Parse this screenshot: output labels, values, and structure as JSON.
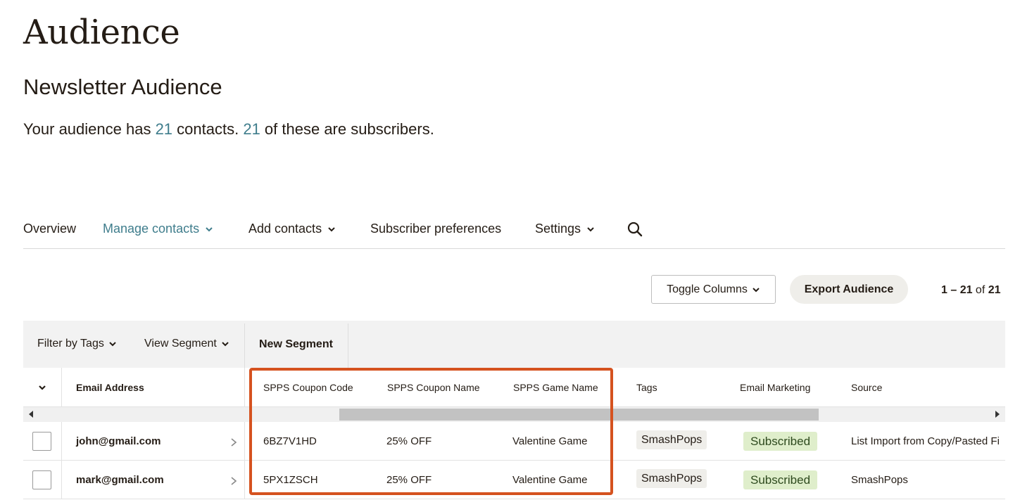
{
  "header": {
    "title": "Audience",
    "audience_name": "Newsletter Audience",
    "summary": {
      "prefix": "Your audience has ",
      "contacts": "21",
      "middle": " contacts. ",
      "subscribers": "21",
      "suffix": " of these are subscribers."
    }
  },
  "nav": {
    "items": [
      {
        "label": "Overview",
        "has_dropdown": false,
        "active": false
      },
      {
        "label": "Manage contacts",
        "has_dropdown": true,
        "active": true
      },
      {
        "label": "Add contacts",
        "has_dropdown": true,
        "active": false
      },
      {
        "label": "Subscriber preferences",
        "has_dropdown": false,
        "active": false
      },
      {
        "label": "Settings",
        "has_dropdown": true,
        "active": false
      }
    ],
    "search_icon": "search-icon",
    "active_color": "#3f7d8c"
  },
  "toolbar": {
    "toggle_columns": "Toggle Columns",
    "export": "Export Audience",
    "pager": {
      "range": "1 – 21",
      "of": " of ",
      "total": "21"
    }
  },
  "filters": {
    "filter_by_tags": "Filter by Tags",
    "view_segment": "View Segment",
    "new_segment": "New Segment"
  },
  "table": {
    "columns": [
      "Email Address",
      "SPPS Coupon Code",
      "SPPS Coupon Name",
      "SPPS Game Name",
      "Tags",
      "Email Marketing",
      "Source"
    ],
    "rows": [
      {
        "email": "john@gmail.com",
        "coupon_code": "6BZ7V1HD",
        "coupon_name": "25% OFF",
        "game_name": "Valentine Game",
        "tag": "SmashPops",
        "status": "Subscribed",
        "source": "List Import from Copy/Pasted Fi"
      },
      {
        "email": "mark@gmail.com",
        "coupon_code": "5PX1ZSCH",
        "coupon_name": "25% OFF",
        "game_name": "Valentine Game",
        "tag": "SmashPops",
        "status": "Subscribed",
        "source": "SmashPops"
      }
    ]
  },
  "colors": {
    "accent": "#3f7d8c",
    "highlight": "#d5521f",
    "subscribed_bg": "#dfeecb"
  }
}
